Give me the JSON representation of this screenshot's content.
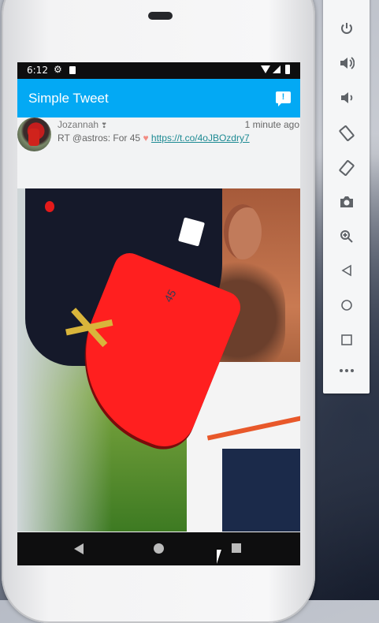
{
  "emulator_panel": {
    "top_labels": [
      "×",
      "–"
    ],
    "buttons": [
      "power-icon",
      "volume-up-icon",
      "volume-down-icon",
      "rotate-left-icon",
      "rotate-right-icon",
      "camera-icon",
      "zoom-icon",
      "back-icon",
      "home-icon",
      "overview-icon",
      "more-icon"
    ]
  },
  "status_bar": {
    "time": "6:12"
  },
  "app_bar": {
    "title": "Simple Tweet"
  },
  "tweet": {
    "user_name": "Jozannah",
    "time_ago": "1 minute ago",
    "text_prefix": "RT @astros: For 45",
    "heart": "♥",
    "link": "https://t.co/4oJBOzdry7"
  },
  "colors": {
    "app_bar": "#03a9f4",
    "link": "#1d8a93",
    "brim": "#ff1f1f",
    "cap": "#15192a"
  }
}
